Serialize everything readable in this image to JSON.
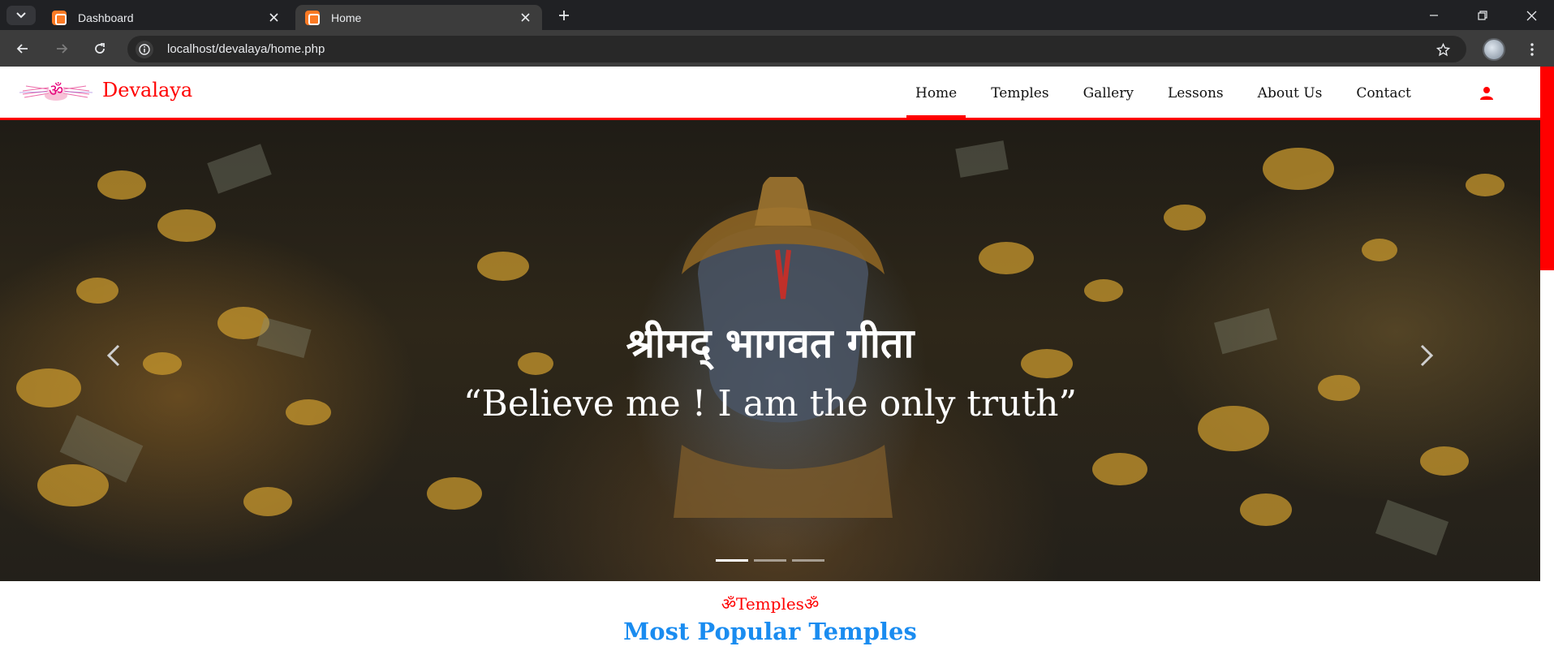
{
  "browser": {
    "tabs": [
      {
        "title": "Dashboard",
        "active": false
      },
      {
        "title": "Home",
        "active": true
      }
    ],
    "url": "localhost/devalaya/home.php"
  },
  "site": {
    "brand": "Devalaya",
    "nav": [
      "Home",
      "Temples",
      "Gallery",
      "Lessons",
      "About Us",
      "Contact"
    ],
    "active_nav": "Home",
    "accent_color": "#ff0000"
  },
  "hero": {
    "title": "श्रीमद् भागवत गीता",
    "quote": "“Believe me ! I am the only truth”",
    "slides": 3,
    "active_slide": 1
  },
  "section": {
    "tag": "ॐTemplesॐ",
    "title": "Most Popular Temples",
    "title_color": "#1a8cf0"
  }
}
